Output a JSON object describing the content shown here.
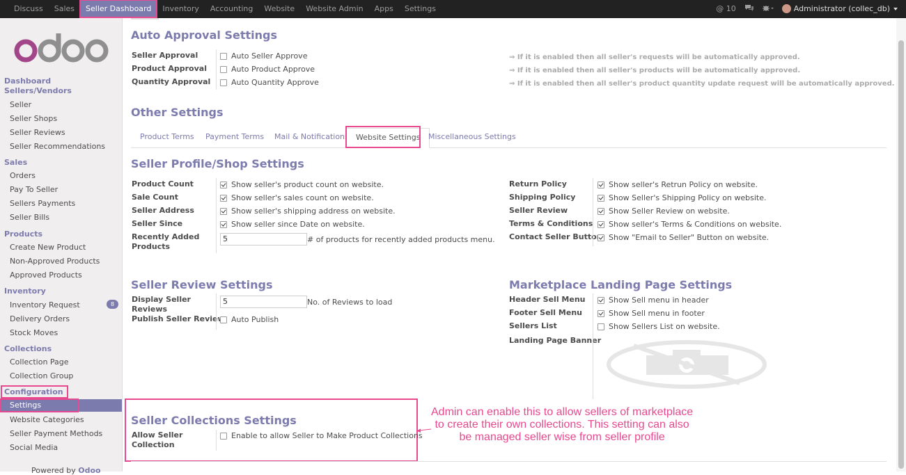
{
  "topbar": {
    "menu": [
      "Discuss",
      "Sales",
      "Seller Dashboard",
      "Inventory",
      "Accounting",
      "Website",
      "Website Admin",
      "Apps",
      "Settings"
    ],
    "messages_count": "10",
    "user": "Administrator (collec_db)"
  },
  "sidebar": {
    "logo_text": "odoo",
    "dashboard": "Dashboard",
    "sellers_vendors": "Sellers/Vendors",
    "seller_items": [
      "Seller",
      "Seller Shops",
      "Seller Reviews",
      "Seller Recommendations"
    ],
    "sales": "Sales",
    "sales_items": [
      "Orders",
      "Pay To Seller",
      "Sellers Payments",
      "Seller Bills"
    ],
    "products": "Products",
    "product_items": [
      "Create New Product",
      "Non-Approved Products",
      "Approved Products"
    ],
    "inventory": "Inventory",
    "inventory_items": [
      "Inventory Request",
      "Delivery Orders",
      "Stock Moves"
    ],
    "inventory_badge": "8",
    "collections": "Collections",
    "collection_items": [
      "Collection Page",
      "Collection Group"
    ],
    "configuration": "Configuration",
    "config_items": [
      "Settings",
      "Website Categories",
      "Seller Payment Methods",
      "Social Media"
    ],
    "powered_by": "Powered by",
    "powered_brand": "Odoo"
  },
  "auto_approval": {
    "title": "Auto Approval Settings",
    "rows": [
      {
        "label": "Seller Approval",
        "option": "Auto Seller Approve",
        "note": "⇒ If it is enabled then all seller's requests will be automatically approved."
      },
      {
        "label": "Product Approval",
        "option": "Auto Product Approve",
        "note": "⇒ If it is enabled then all seller's products will be automatically approved."
      },
      {
        "label": "Quantity Approval",
        "option": "Auto Quantity Approve",
        "note": "⇒ If it is enabled then all seller's product quantity update request will be automatically approved."
      }
    ]
  },
  "other_settings": {
    "title": "Other Settings",
    "tabs": [
      "Product Terms",
      "Payment Terms",
      "Mail & Notifications",
      "Website Settings",
      "Miscellaneous Settings"
    ]
  },
  "profile": {
    "title": "Seller Profile/Shop Settings",
    "left": [
      {
        "label": "Product Count",
        "text": "Show seller's product count on website."
      },
      {
        "label": "Sale Count",
        "text": "Show seller's sales count on website."
      },
      {
        "label": "Seller Address",
        "text": "Show seller's shipping address on website."
      },
      {
        "label": "Seller Since",
        "text": "Show seller since Date on website."
      }
    ],
    "recent_label": "Recently Added Products",
    "recent_value": "5",
    "recent_suffix": "# of products for recently added products menu.",
    "right": [
      {
        "label": "Return Policy",
        "text": "Show seller's Retrun Policy on website."
      },
      {
        "label": "Shipping Policy",
        "text": "Show Seller's Shipping Policy on website."
      },
      {
        "label": "Seller Review",
        "text": "Show Seller Review on website."
      },
      {
        "label": "Terms & Conditions",
        "text": "Show seller's Terms & Conditions on website."
      },
      {
        "label": "Contact Seller Button",
        "text": "Show \"Email to Seller\" Button on website."
      }
    ]
  },
  "review": {
    "title": "Seller Review Settings",
    "display_label": "Display Seller Reviews",
    "display_value": "5",
    "display_suffix": "No. of Reviews to load",
    "publish_label": "Publish Seller Review",
    "publish_text": "Auto Publish"
  },
  "landing": {
    "title": "Marketplace Landing Page Settings",
    "rows": [
      {
        "label": "Header Sell Menu",
        "text": "Show Sell menu in header",
        "checked": true
      },
      {
        "label": "Footer Sell Menu",
        "text": "Show Sell menu in footer",
        "checked": true
      },
      {
        "label": "Sellers List",
        "text": "Show Sellers List on website.",
        "checked": false
      }
    ],
    "banner_label": "Landing Page Banner"
  },
  "collections_settings": {
    "title": "Seller Collections Settings",
    "label": "Allow Seller Collection",
    "text": "Enable to allow Seller to Make Product Collections"
  },
  "annotation": {
    "line1": "Admin can enable this to allow sellers of marketplace",
    "line2": "to create their own collections. This setting can also",
    "line3": "be managed seller wise from seller profile"
  },
  "colors": {
    "accent": "#7c7bad",
    "highlight": "#e8488f",
    "topbar": "#222222"
  }
}
